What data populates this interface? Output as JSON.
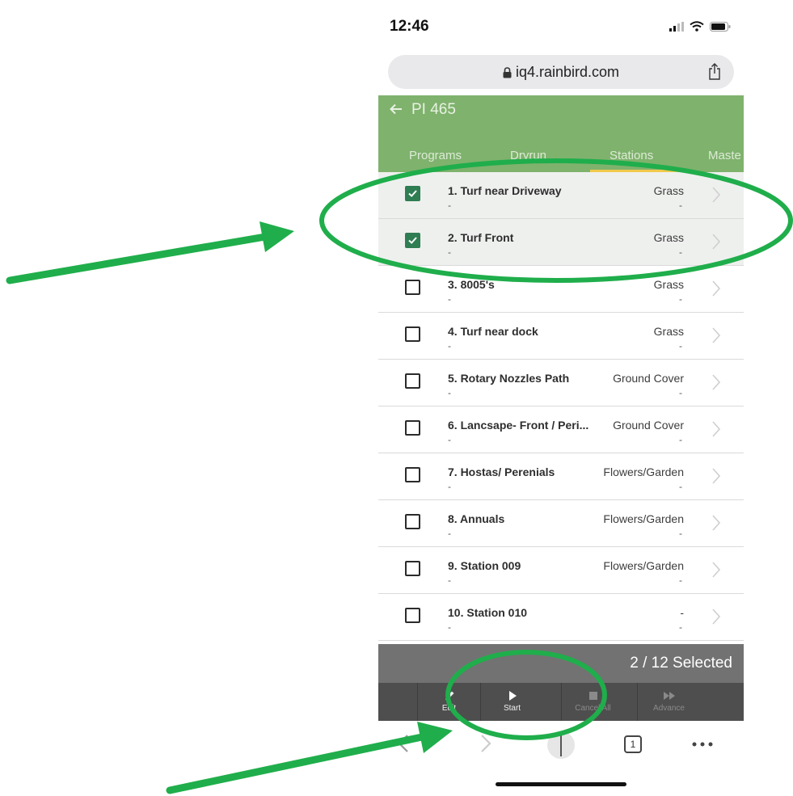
{
  "status_bar": {
    "time": "12:46"
  },
  "browser": {
    "url": "iq4.rainbird.com"
  },
  "header": {
    "title": "PI 465"
  },
  "tabs": [
    {
      "label": "Programs"
    },
    {
      "label": "Dryrun"
    },
    {
      "label": "Stations"
    },
    {
      "label": "Maste"
    }
  ],
  "stations": [
    {
      "name": "1. Turf near Driveway",
      "sub": "-",
      "type": "Grass",
      "type_sub": "-",
      "checked": true
    },
    {
      "name": "2. Turf Front",
      "sub": "-",
      "type": "Grass",
      "type_sub": "-",
      "checked": true
    },
    {
      "name": "3. 8005's",
      "sub": "-",
      "type": "Grass",
      "type_sub": "-",
      "checked": false
    },
    {
      "name": "4. Turf near dock",
      "sub": "-",
      "type": "Grass",
      "type_sub": "-",
      "checked": false
    },
    {
      "name": "5. Rotary Nozzles Path",
      "sub": "-",
      "type": "Ground Cover",
      "type_sub": "-",
      "checked": false
    },
    {
      "name": "6. Lancsape- Front / Peri...",
      "sub": "-",
      "type": "Ground Cover",
      "type_sub": "-",
      "checked": false
    },
    {
      "name": "7. Hostas/ Perenials",
      "sub": "-",
      "type": "Flowers/Garden",
      "type_sub": "-",
      "checked": false
    },
    {
      "name": "8. Annuals",
      "sub": "-",
      "type": "Flowers/Garden",
      "type_sub": "-",
      "checked": false
    },
    {
      "name": "9. Station 009",
      "sub": "-",
      "type": "Flowers/Garden",
      "type_sub": "-",
      "checked": false
    },
    {
      "name": "10. Station 010",
      "sub": "-",
      "type": "-",
      "type_sub": "-",
      "checked": false
    }
  ],
  "selection": {
    "count_label": "2 / 12 Selected"
  },
  "actions": [
    {
      "label": "Edit",
      "enabled": true
    },
    {
      "label": "Start",
      "enabled": true
    },
    {
      "label": "Cancel All",
      "enabled": false
    },
    {
      "label": "Advance",
      "enabled": false
    }
  ],
  "browser_toolbar": {
    "tab_count": "1"
  },
  "colors": {
    "header_green": "#7fb26d",
    "checkbox_green": "#2f7d52",
    "annotation_green": "#1fae4b",
    "tab_indicator": "#f2c94c"
  }
}
